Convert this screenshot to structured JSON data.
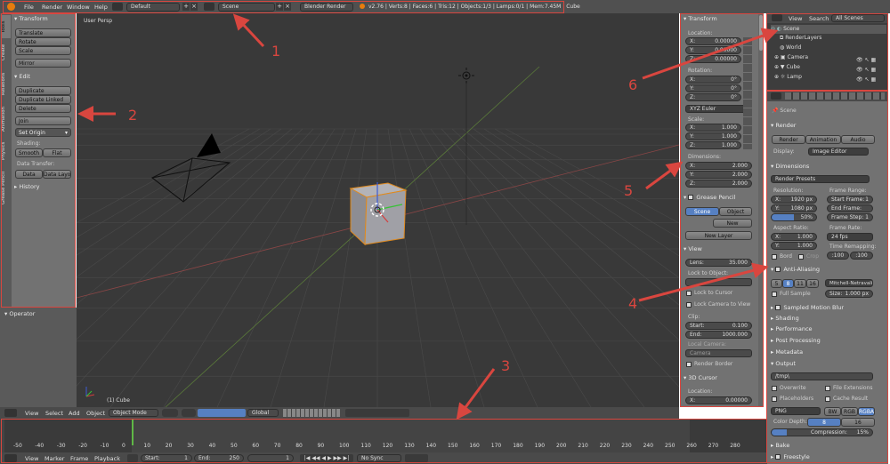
{
  "topbar": {
    "menus": [
      "File",
      "Render",
      "Window",
      "Help"
    ],
    "layout": "Default",
    "scene": "Scene",
    "engine": "Blender Render",
    "stats": "v2.76 | Verts:8 | Faces:6 | Tris:12 | Objects:1/3 | Lamps:0/1 | Mem:7.45M | Cube"
  },
  "tools": {
    "tabs": [
      "Tools",
      "Create",
      "Relations",
      "Animation",
      "Physics",
      "Grease Pencil"
    ],
    "transform_title": "Transform",
    "translate": "Translate",
    "rotate": "Rotate",
    "scale": "Scale",
    "mirror": "Mirror",
    "edit_title": "Edit",
    "duplicate": "Duplicate",
    "duplicate_linked": "Duplicate Linked",
    "delete": "Delete",
    "join": "Join",
    "set_origin": "Set Origin",
    "shading_label": "Shading:",
    "smooth": "Smooth",
    "flat": "Flat",
    "data_transfer_label": "Data Transfer:",
    "data": "Data",
    "data_layo": "Data Layo",
    "history": "History"
  },
  "operator": {
    "title": "Operator"
  },
  "viewport": {
    "label": "User Persp",
    "object_label": "(1) Cube"
  },
  "view3d_header": {
    "menus": [
      "View",
      "Select",
      "Add",
      "Object"
    ],
    "mode": "Object Mode",
    "orientation": "Global"
  },
  "timeline": {
    "ticks": [
      "-50",
      "-40",
      "-30",
      "-20",
      "-10",
      "0",
      "10",
      "20",
      "30",
      "40",
      "50",
      "60",
      "70",
      "80",
      "90",
      "100",
      "110",
      "120",
      "130",
      "140",
      "150",
      "160",
      "170",
      "180",
      "190",
      "200",
      "210",
      "220",
      "230",
      "240",
      "250",
      "260",
      "270",
      "280"
    ],
    "menus": [
      "View",
      "Marker",
      "Frame",
      "Playback"
    ],
    "start_label": "Start:",
    "start": "1",
    "end_label": "End:",
    "end": "250",
    "current": "1",
    "sync": "No Sync"
  },
  "npanel": {
    "transform": "Transform",
    "location": "Location:",
    "loc": [
      "X:",
      "Y:",
      "Z:"
    ],
    "loc_vals": [
      "0.00000",
      "0.00000",
      "0.00000"
    ],
    "rotation": "Rotation:",
    "rot_vals": [
      "0°",
      "0°",
      "0°"
    ],
    "rot_mode": "XYZ Euler",
    "scale": "Scale:",
    "scale_vals": [
      "1.000",
      "1.000",
      "1.000"
    ],
    "dimensions": "Dimensions:",
    "dim_vals": [
      "2.000",
      "2.000",
      "2.000"
    ],
    "grease_pencil": "Grease Pencil",
    "gp_scene": "Scene",
    "gp_object": "Object",
    "gp_new": "New",
    "gp_new_layer": "New Layer",
    "view": "View",
    "lens_label": "Lens:",
    "lens": "35.000",
    "lock_to_object": "Lock to Object:",
    "lock_to_cursor": "Lock to Cursor",
    "lock_camera": "Lock Camera to View",
    "clip": "Clip:",
    "clip_start_label": "Start:",
    "clip_start": "0.100",
    "clip_end_label": "End:",
    "clip_end": "1000.000",
    "local_camera": "Local Camera:",
    "camera_field": "Camera",
    "render_border": "Render Border",
    "cursor_3d": "3D Cursor",
    "cursor_location": "Location:",
    "cursor_x": "X:",
    "cursor_x_val": "0.00000"
  },
  "outliner": {
    "tabs": [
      "View",
      "Search",
      "All Scenes"
    ],
    "items": [
      "Scene",
      "RenderLayers",
      "World",
      "Camera",
      "Cube",
      "Lamp"
    ]
  },
  "properties": {
    "scene_label": "Scene",
    "render_section": "Render",
    "render_btn": "Render",
    "animation_btn": "Animation",
    "audio_btn": "Audio",
    "display_label": "Display:",
    "display_val": "Image Editor",
    "dimensions_section": "Dimensions",
    "render_presets": "Render Presets",
    "resolution": "Resolution:",
    "res_x_label": "X:",
    "res_x": "1920 px",
    "res_y_label": "Y:",
    "res_y": "1080 px",
    "res_pct": "50%",
    "frame_range": "Frame Range:",
    "start_frame_label": "Start Frame:",
    "start_frame": "1",
    "end_frame_label": "End Frame:",
    "end_frame": "250",
    "frame_step_label": "Frame Step:",
    "frame_step": "1",
    "aspect_ratio": "Aspect Ratio:",
    "asp_x": "1.000",
    "asp_y": "1.000",
    "frame_rate": "Frame Rate:",
    "fps": "24 fps",
    "time_remap": "Time Remapping:",
    "remap_old": ":100",
    "remap_new": ":100",
    "bord": "Bord",
    "crop": "Crop",
    "aa_section": "Anti-Aliasing",
    "aa_samples": [
      "5",
      "8",
      "11",
      "16"
    ],
    "aa_filter": "Mitchell-Netravali",
    "full_sample": "Full Sample",
    "size_label": "Size:",
    "size_val": "1.000 px",
    "sampled_motion_blur": "Sampled Motion Blur",
    "shading": "Shading",
    "performance": "Performance",
    "post_processing": "Post Processing",
    "metadata": "Metadata",
    "output_section": "Output",
    "output_path": "/tmp\\",
    "overwrite": "Overwrite",
    "file_extensions": "File Extensions",
    "placeholders": "Placeholders",
    "cache_result": "Cache Result",
    "format": "PNG",
    "bw": "BW",
    "rgb": "RGB",
    "rgba": "RGBA",
    "color_depth_label": "Color Depth:",
    "depth_8": "8",
    "depth_16": "16",
    "compression_label": "Compression:",
    "compression": "15%",
    "bake": "Bake",
    "freestyle": "Freestyle"
  },
  "annotations": [
    "1",
    "2",
    "3",
    "4",
    "5",
    "6"
  ],
  "colors": {
    "accent": "#5680c2",
    "annotation_red": "#d9463f",
    "viewport_bg": "#393939",
    "panel_bg": "#727272"
  }
}
